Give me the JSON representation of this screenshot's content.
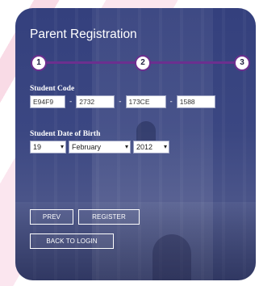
{
  "form": {
    "title": "Parent Registration",
    "steps": [
      "1",
      "2",
      "3"
    ],
    "student_code": {
      "label": "Student Code",
      "parts": [
        "E94F9",
        "2732",
        "173CE",
        "1588"
      ],
      "separator": "-"
    },
    "dob": {
      "label": "Student Date of Birth",
      "day": "19",
      "month": "February",
      "year": "2012",
      "chevron": "▾"
    },
    "buttons": {
      "prev": "PREV",
      "register": "REGISTER",
      "back": "BACK TO LOGIN"
    }
  },
  "colors": {
    "step_accent": "#6c2f8f",
    "panel_bg": "#3b4782",
    "ribbon": "#fbe6ef"
  }
}
